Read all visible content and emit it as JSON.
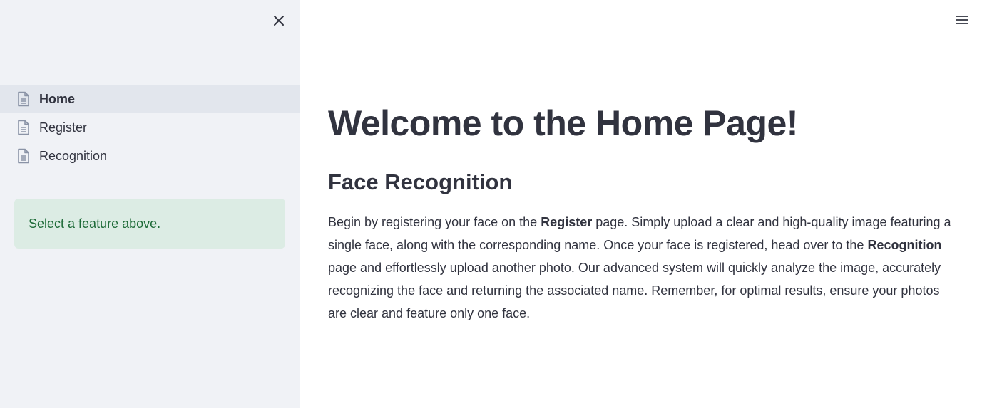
{
  "sidebar": {
    "nav_items": [
      {
        "label": "Home",
        "active": true,
        "icon": "document-icon"
      },
      {
        "label": "Register",
        "active": false,
        "icon": "document-icon"
      },
      {
        "label": "Recognition",
        "active": false,
        "icon": "document-icon"
      }
    ],
    "alert_text": "Select a feature above.",
    "close_icon": "close-icon"
  },
  "header": {
    "menu_icon": "hamburger-menu-icon"
  },
  "main": {
    "title": "Welcome to the Home Page!",
    "subtitle": "Face Recognition",
    "paragraph": {
      "part1": "Begin by registering your face on the ",
      "bold1": "Register",
      "part2": " page. Simply upload a clear and high-quality image featuring a single face, along with the corresponding name. Once your face is registered, head over to the ",
      "bold2": "Recognition",
      "part3": " page and effortlessly upload another photo. Our advanced system will quickly analyze the image, accurately recognizing the face and returning the associated name. Remember, for optimal results, ensure your photos are clear and feature only one face."
    }
  },
  "colors": {
    "sidebar_bg": "#f0f2f6",
    "active_nav_bg": "#e2e6ed",
    "alert_bg": "#dcece4",
    "alert_text": "#1e6b38",
    "text": "#31333f"
  }
}
